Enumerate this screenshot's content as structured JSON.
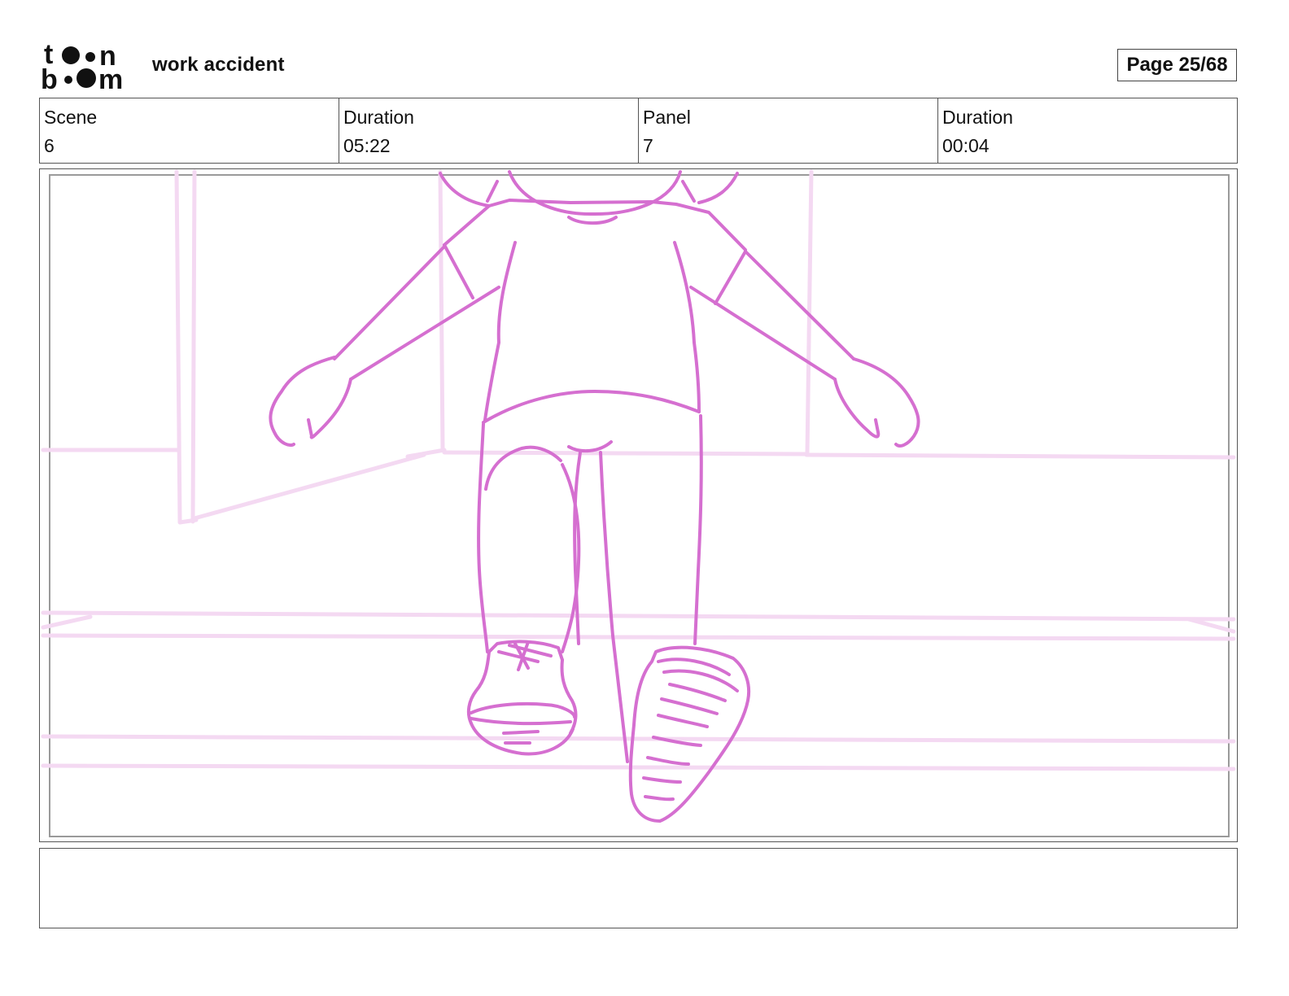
{
  "header": {
    "logo_text": "toon boom",
    "project_title": "work accident",
    "page": "Page 25/68"
  },
  "info": {
    "scene_label": "Scene",
    "scene_value": "6",
    "scene_duration_label": "Duration",
    "scene_duration_value": "05:22",
    "panel_label": "Panel",
    "panel_value": "7",
    "panel_duration_label": "Duration",
    "panel_duration_value": "00:04"
  },
  "colors": {
    "sketch_main": "#d56fd0",
    "sketch_background": "#f4d9f2",
    "border": "#555555"
  },
  "notes": {
    "text": ""
  }
}
